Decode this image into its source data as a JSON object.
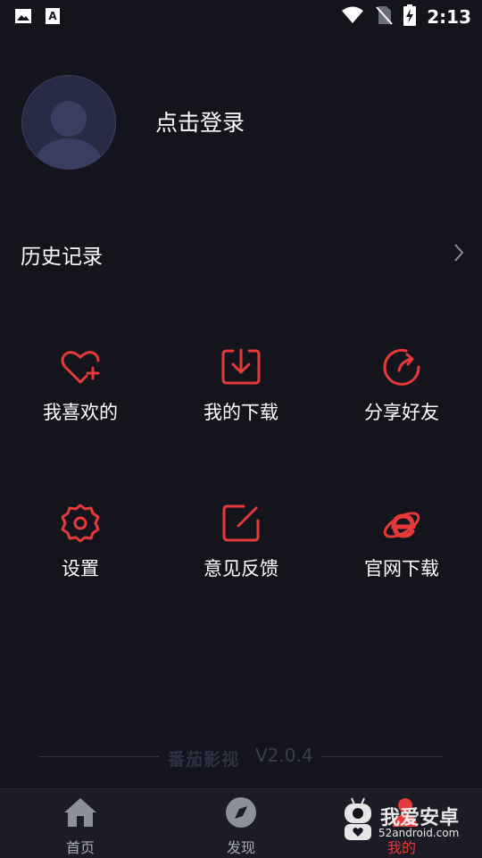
{
  "status_bar": {
    "time": "2:13"
  },
  "profile": {
    "login_text": "点击登录"
  },
  "history": {
    "label": "历史记录"
  },
  "menu": [
    {
      "id": "favorites",
      "label": "我喜欢的",
      "icon": "heart-plus-icon"
    },
    {
      "id": "downloads",
      "label": "我的下载",
      "icon": "download-icon"
    },
    {
      "id": "share",
      "label": "分享好友",
      "icon": "share-icon"
    },
    {
      "id": "settings",
      "label": "设置",
      "icon": "gear-icon"
    },
    {
      "id": "feedback",
      "label": "意见反馈",
      "icon": "edit-icon"
    },
    {
      "id": "official",
      "label": "官网下载",
      "icon": "browser-e-icon"
    }
  ],
  "footer": {
    "brand": "番茄影视",
    "version": "V2.0.4"
  },
  "tabs": [
    {
      "label": "首页",
      "icon": "home-icon",
      "active": false
    },
    {
      "label": "发现",
      "icon": "compass-icon",
      "active": false
    },
    {
      "label": "我的",
      "icon": "profile-icon",
      "active": true
    }
  ],
  "watermark": {
    "title": "我爱安卓",
    "site": "52android.com"
  },
  "colors": {
    "background": "#14141d",
    "accent": "#e53a3a",
    "tabbar": "#1b1c26"
  }
}
